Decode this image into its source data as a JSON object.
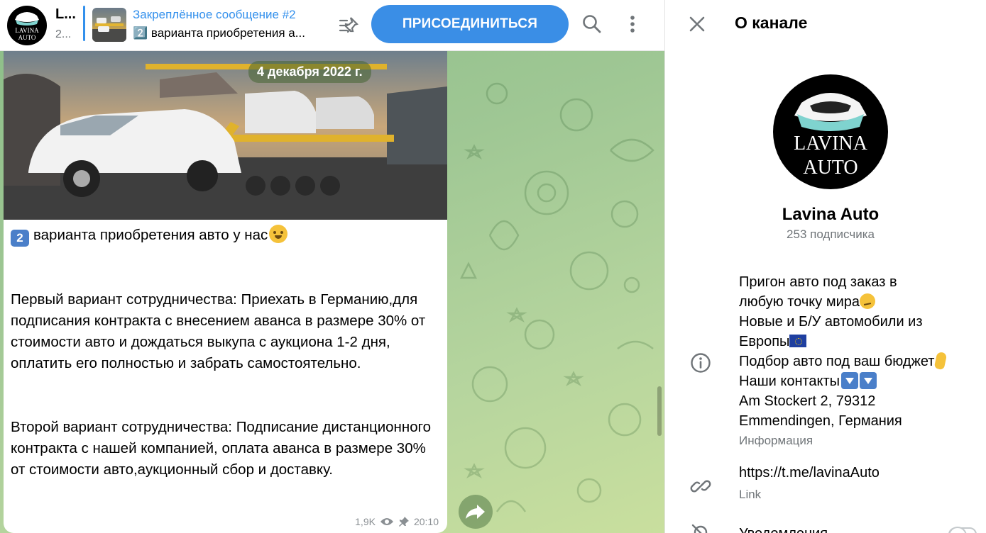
{
  "header": {
    "channel_title_short": "L...",
    "channel_sub_short": "2...",
    "pinned_title": "Закреплённое сообщение #2",
    "pinned_text": "2️⃣ варианта приобретения а...",
    "join_label": "ПРИСОЕДИНИТЬСЯ",
    "icons": [
      "pin-list-icon",
      "search-icon",
      "more-vertical-icon"
    ]
  },
  "logo": {
    "line1": "LAVINA",
    "line2": "AUTO"
  },
  "message": {
    "date_badge": "4 декабря 2022 г.",
    "keycap": "2",
    "headline": "варианта приобретения авто у нас",
    "paragraph1": "Первый вариант сотрудничества: Приехать в Германию,для подписания контракта с внесением аванса в размере 30% от стоимости авто и дождаться выкупа с аукциона 1-2 дня, оплатить его полностью и забрать самостоятельно.",
    "paragraph2": "Второй вариант сотрудничества: Подписание дистанционного контракта с нашей компанией, оплата аванса в размере 30% от стоимости авто,аукционный сбор и доставку.",
    "views": "1,9K",
    "time": "20:10"
  },
  "panel": {
    "title": "О канале",
    "name": "Lavina Auto",
    "subscribers": "253 подписчика",
    "desc": {
      "line1": "Пригон авто под заказ в",
      "line2": "любую точку мира",
      "line3": "Новые и Б/У автомобили из",
      "line4": "Европы",
      "line5": "Подбор авто под ваш бюджет",
      "line6": "Наши контакты",
      "line7": "Am Stockert 2, 79312",
      "line8": "Emmendingen, Германия"
    },
    "info_label": "Информация",
    "link": "https://t.me/lavinaAuto",
    "link_label": "Link",
    "notifications_label": "Уведомления"
  },
  "colors": {
    "accent": "#3390ec",
    "join_button": "#3a8ee6",
    "chat_bg": "#9fc794",
    "secondary_text": "#707579"
  }
}
